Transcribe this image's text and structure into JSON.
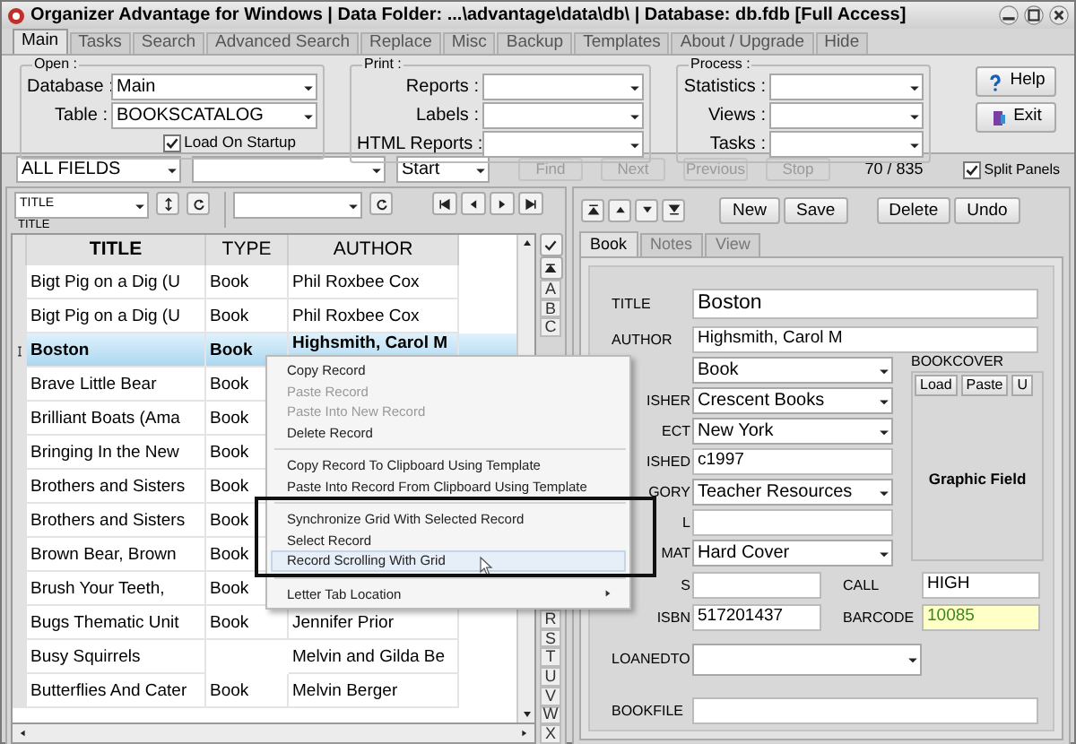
{
  "window": {
    "title": "Organizer Advantage for Windows | Data Folder: ...\\advantage\\data\\db\\ | Database: db.fdb [Full Access]"
  },
  "tabs": [
    {
      "label": "Main",
      "selected": true
    },
    {
      "label": "Tasks",
      "selected": false
    },
    {
      "label": "Search",
      "selected": false
    },
    {
      "label": "Advanced Search",
      "selected": false
    },
    {
      "label": "Replace",
      "selected": false
    },
    {
      "label": "Misc",
      "selected": false
    },
    {
      "label": "Backup",
      "selected": false
    },
    {
      "label": "Templates",
      "selected": false
    },
    {
      "label": "About / Upgrade",
      "selected": false
    },
    {
      "label": "Hide",
      "selected": false
    }
  ],
  "open_group": {
    "title": "Open :",
    "fields": [
      {
        "label": "Database :",
        "value": "Main"
      },
      {
        "label": "Table :",
        "value": "BOOKSCATALOG"
      }
    ],
    "load_on_startup": {
      "label": "Load On Startup",
      "checked": true
    }
  },
  "print_group": {
    "title": "Print :",
    "fields": [
      {
        "label": "Reports :"
      },
      {
        "label": "Labels :"
      },
      {
        "label": "HTML Reports :"
      }
    ]
  },
  "process_group": {
    "title": "Process :",
    "fields": [
      {
        "label": "Statistics :"
      },
      {
        "label": "Views :"
      },
      {
        "label": "Tasks :"
      }
    ]
  },
  "buttons": [
    {
      "label": "Help",
      "kind": "help"
    },
    {
      "label": "Exit",
      "kind": "exit"
    }
  ],
  "search_bar": {
    "field": "ALL FIELDS",
    "match": "Start",
    "buttons": [
      {
        "label": "Find",
        "disabled": true
      },
      {
        "label": "Next",
        "disabled": true
      },
      {
        "label": "Previous",
        "disabled": true
      },
      {
        "label": "Stop",
        "disabled": true
      }
    ],
    "count": "70 / 835",
    "split_panels": {
      "label": "Split Panels",
      "checked": true
    }
  },
  "grid_toolbar": {
    "sort_field": "TITLE",
    "sort_caption": "TITLE"
  },
  "grid": {
    "columns": [
      "TITLE",
      "TYPE",
      "AUTHOR"
    ],
    "rows": [
      {
        "cells": [
          "Bigt Pig on a Dig (U",
          "Book",
          "Phil Roxbee Cox"
        ],
        "selected": false
      },
      {
        "cells": [
          "Bigt Pig on a Dig (U",
          "Book",
          "Phil Roxbee Cox"
        ],
        "selected": false
      },
      {
        "cells": [
          "Boston",
          "Book",
          "Highsmith, Carol M"
        ],
        "selected": true
      },
      {
        "cells": [
          "Brave Little Bear",
          "Book"
        ],
        "selected": false
      },
      {
        "cells": [
          "Brilliant Boats (Ama",
          "Book"
        ],
        "selected": false
      },
      {
        "cells": [
          "Bringing In the New",
          "Book"
        ],
        "selected": false
      },
      {
        "cells": [
          "Brothers and Sisters",
          "Book"
        ],
        "selected": false
      },
      {
        "cells": [
          "Brothers and Sisters",
          "Book"
        ],
        "selected": false
      },
      {
        "cells": [
          "Brown Bear, Brown",
          "Book"
        ],
        "selected": false
      },
      {
        "cells": [
          "Brush Your Teeth,",
          "Book"
        ],
        "selected": false
      },
      {
        "cells": [
          "Bugs Thematic Unit",
          "Book",
          "Jennifer Prior"
        ],
        "selected": false
      },
      {
        "cells": [
          "Busy Squirrels",
          "",
          "Melvin and Gilda Be"
        ],
        "selected": false
      },
      {
        "cells": [
          "Butterflies And Cater",
          "Book",
          "Melvin Berger"
        ],
        "selected": false
      }
    ]
  },
  "letter_tabs_top": [
    "A",
    "B",
    "C"
  ],
  "letter_tabs_bottom": [
    "R",
    "S",
    "T",
    "U",
    "V",
    "W",
    "X"
  ],
  "record_toolbar": {
    "buttons": [
      "New",
      "Save",
      "Delete",
      "Undo"
    ]
  },
  "record_tabs": [
    {
      "label": "Book",
      "selected": true
    },
    {
      "label": "Notes",
      "selected": false
    },
    {
      "label": "View",
      "selected": false
    }
  ],
  "form": {
    "title": {
      "label": "TITLE",
      "value": "Boston"
    },
    "author": {
      "label": "AUTHOR",
      "value": "Highsmith, Carol M"
    },
    "middle": [
      {
        "value": "Book",
        "kind": "select"
      },
      {
        "label": "ISHER",
        "value": "Crescent Books",
        "kind": "select"
      },
      {
        "label": "ECT",
        "value": "New York",
        "kind": "select"
      },
      {
        "label": "ISHED",
        "value": "c1997",
        "kind": "text"
      },
      {
        "label": "GORY",
        "value": "Teacher Resources",
        "kind": "select"
      },
      {
        "label": "L",
        "kind": "text"
      },
      {
        "label": "MAT",
        "value": "Hard Cover",
        "kind": "select"
      }
    ],
    "bookcover": {
      "label": "BOOKCOVER",
      "buttons": [
        "Load",
        "Paste",
        "U"
      ],
      "caption": "Graphic Field"
    },
    "pairs": [
      [
        {
          "label": "S"
        },
        {
          "label": "CALL",
          "value": "HIGH",
          "highlight": false
        }
      ],
      [
        {
          "label": "ISBN",
          "value": "517201437"
        },
        {
          "label": "BARCODE",
          "value": "10085",
          "highlight": true
        }
      ]
    ],
    "loanedto": {
      "label": "LOANEDTO"
    },
    "bookfile": {
      "label": "BOOKFILE"
    }
  },
  "context_menu": {
    "items": [
      {
        "kind": "item",
        "label": "Copy Record",
        "disabled": false,
        "highlighted": false,
        "submenu": false
      },
      {
        "kind": "item",
        "label": "Paste Record",
        "disabled": true,
        "highlighted": false,
        "submenu": false
      },
      {
        "kind": "item",
        "label": "Paste Into New Record",
        "disabled": true,
        "highlighted": false,
        "submenu": false
      },
      {
        "kind": "item",
        "label": "Delete Record",
        "disabled": false,
        "highlighted": false,
        "submenu": false
      },
      {
        "kind": "separator"
      },
      {
        "kind": "item",
        "label": "Copy Record To Clipboard Using Template",
        "disabled": false,
        "highlighted": false,
        "submenu": false
      },
      {
        "kind": "item",
        "label": "Paste Into Record From Clipboard Using Template",
        "disabled": false,
        "highlighted": false,
        "submenu": false
      },
      {
        "kind": "separator"
      },
      {
        "kind": "item",
        "label": "Synchronize Grid With Selected Record",
        "disabled": false,
        "highlighted": false,
        "submenu": false
      },
      {
        "kind": "item",
        "label": "Select Record",
        "disabled": false,
        "highlighted": false,
        "submenu": false
      },
      {
        "kind": "item",
        "label": "Record Scrolling With Grid",
        "disabled": false,
        "highlighted": true,
        "submenu": false
      },
      {
        "kind": "separator"
      },
      {
        "kind": "item",
        "label": "Letter Tab Location",
        "disabled": false,
        "highlighted": false,
        "submenu": true
      }
    ]
  }
}
